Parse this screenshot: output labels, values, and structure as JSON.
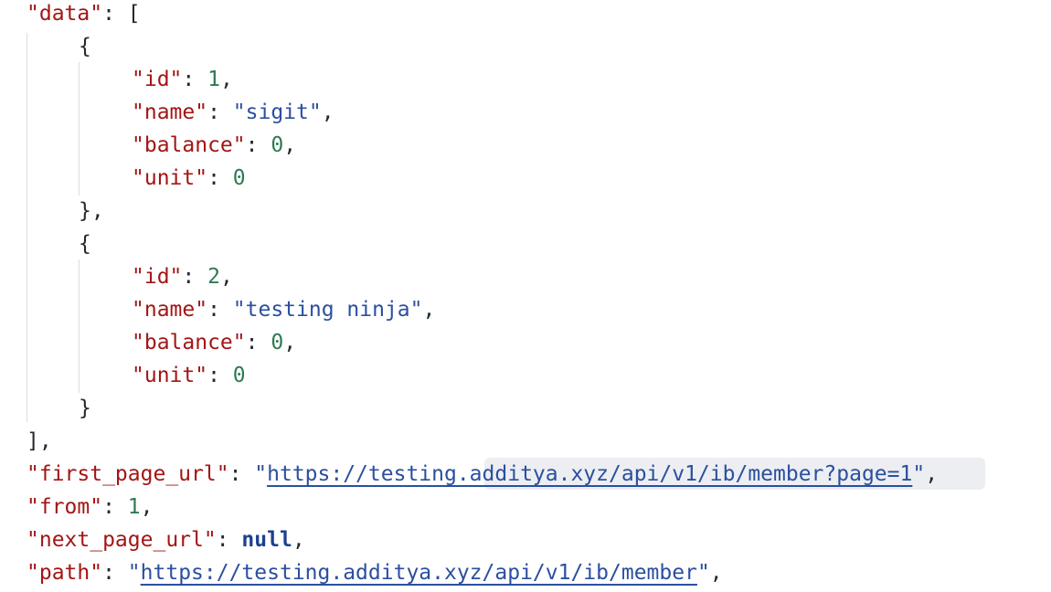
{
  "json_view": {
    "data_key": "\"data\"",
    "items": [
      {
        "id_key": "\"id\"",
        "id_value": "1",
        "name_key": "\"name\"",
        "name_value": "\"sigit\"",
        "balance_key": "\"balance\"",
        "balance_value": "0",
        "unit_key": "\"unit\"",
        "unit_value": "0"
      },
      {
        "id_key": "\"id\"",
        "id_value": "2",
        "name_key": "\"name\"",
        "name_value": "\"testing ninja\"",
        "balance_key": "\"balance\"",
        "balance_value": "0",
        "unit_key": "\"unit\"",
        "unit_value": "0"
      }
    ],
    "first_page_url_key": "\"first_page_url\"",
    "first_page_url": "https://testing.additya.xyz/api/v1/ib/member?page=1",
    "from_key": "\"from\"",
    "from_value": "1",
    "next_page_url_key": "\"next_page_url\"",
    "next_page_url_value": "null",
    "path_key": "\"path\"",
    "path_url": "https://testing.additya.xyz/api/v1/ib/member",
    "colors": {
      "key": "#a31515",
      "string": "#2b4fa0",
      "number": "#2e7a52",
      "keyword": "#1d3f8f",
      "highlight": "#eceef1"
    }
  }
}
